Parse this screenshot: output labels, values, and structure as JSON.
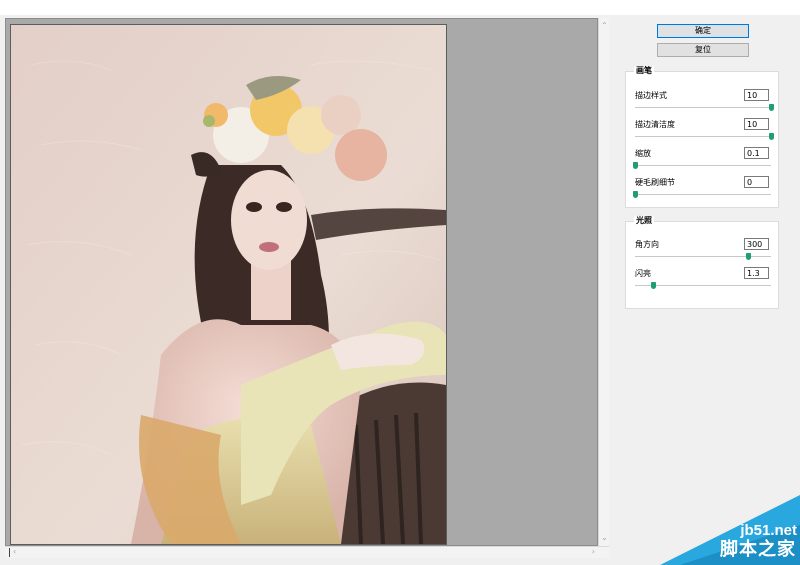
{
  "buttons": {
    "ok_label": "确定",
    "reset_label": "复位"
  },
  "brush_group": {
    "title": "画笔",
    "params": [
      {
        "label": "描边样式",
        "value": "10",
        "slider_fraction": 1.0
      },
      {
        "label": "描边清洁度",
        "value": "10",
        "slider_fraction": 1.0
      },
      {
        "label": "缩放",
        "value": "0.1",
        "slider_fraction": 0.0
      },
      {
        "label": "硬毛刷细节",
        "value": "0",
        "slider_fraction": 0.0
      }
    ]
  },
  "lighting_group": {
    "title": "光照",
    "params": [
      {
        "label": "角方向",
        "value": "300",
        "slider_fraction": 0.83
      },
      {
        "label": "闪亮",
        "value": "1.3",
        "slider_fraction": 0.13
      }
    ]
  },
  "watermark": {
    "site": "jb51.net",
    "name": "脚本之家"
  },
  "colors": {
    "accent": "#0078d7",
    "slider_thumb": "#1f9e74",
    "preview_bg": "#a9a9a9",
    "watermark_blue": "#29a8e0"
  }
}
